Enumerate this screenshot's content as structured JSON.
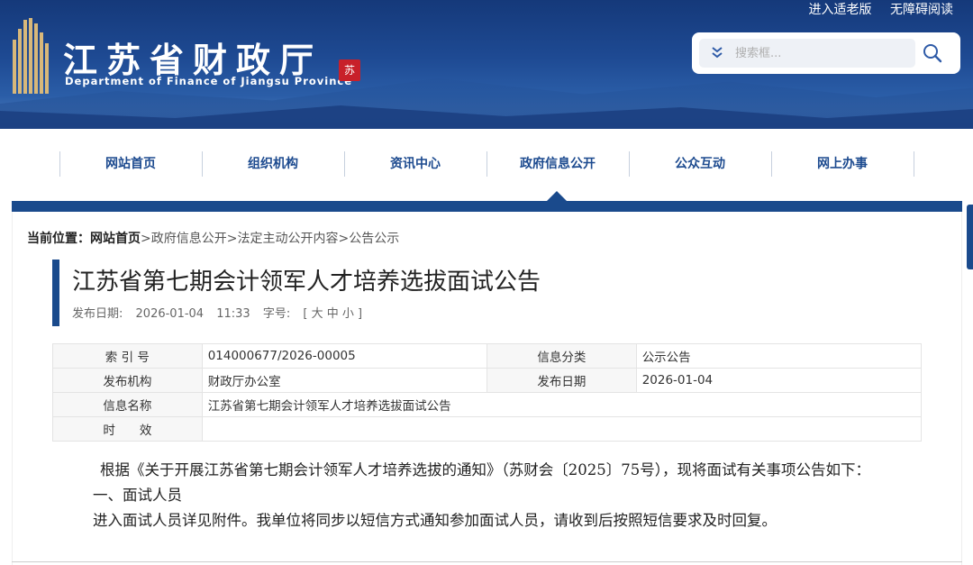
{
  "header": {
    "site_title": "江苏省财政厅",
    "site_subtitle": "Department of Finance of Jiangsu Province",
    "seal_text": "苏",
    "links": [
      "进入适老版",
      "无障碍阅读"
    ],
    "search_placeholder": "搜索框..."
  },
  "nav": {
    "items": [
      "网站首页",
      "组织机构",
      "资讯中心",
      "政府信息公开",
      "公众互动",
      "网上办事"
    ],
    "active": "政府信息公开"
  },
  "breadcrumb": {
    "label": "当前位置：",
    "home": "网站首页",
    "path": ">政府信息公开>法定主动公开内容>公告公示"
  },
  "article": {
    "title": "江苏省第七期会计领军人才培养选拔面试公告",
    "publish_label": "发布日期:",
    "publish_date": "2026-01-04",
    "publish_time": "11:33",
    "fontsize_label": "字号:",
    "fontsize_options": "[ 大 中 小 ]"
  },
  "info_table": {
    "rows": [
      {
        "l1": "索 引 号",
        "v1": "014000677/2026-00005",
        "l2": "信息分类",
        "v2": "公示公告"
      },
      {
        "l1": "发布机构",
        "v1": "财政厅办公室",
        "l2": "发布日期",
        "v2": "2026-01-04"
      }
    ],
    "name_label": "信息名称",
    "name_value": "江苏省第七期会计领军人才培养选拔面试公告",
    "valid_label": "时　　效",
    "valid_value": ""
  },
  "body": {
    "para1": "根据《关于开展江苏省第七期会计领军人才培养选拔的通知》（苏财会〔2025〕75号），现将面试有关事项公告如下：",
    "heading1": "一、面试人员",
    "para2": "进入面试人员详见附件。我单位将同步以短信方式通知参加面试人员，请收到后按照短信要求及时回复。"
  },
  "colors": {
    "primary": "#1a4a8c",
    "nav_text": "#1c4a8f",
    "seal": "#c8202a"
  }
}
